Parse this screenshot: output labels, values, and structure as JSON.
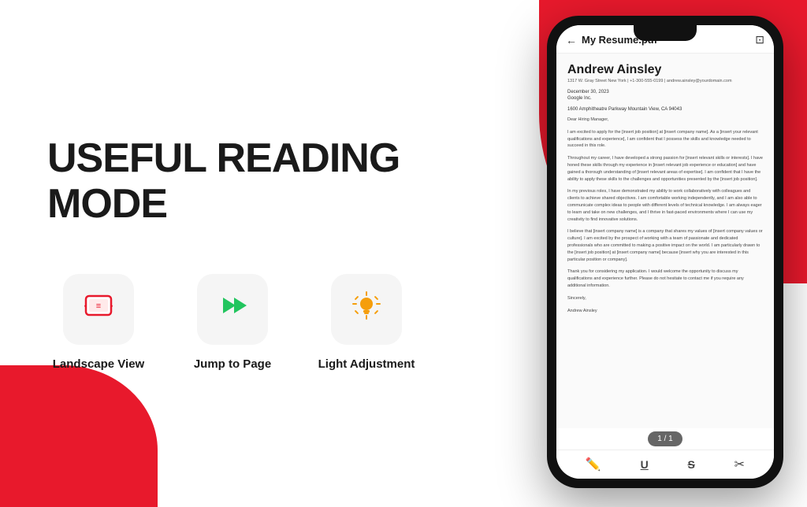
{
  "background": {
    "top_right_color": "#e8192c",
    "bottom_left_color": "#e8192c"
  },
  "left_section": {
    "title": "USEFUL READING MODE",
    "features": [
      {
        "id": "landscape-view",
        "icon": "📄",
        "icon_symbol": "⬛",
        "label": "Landscape View",
        "icon_color": "red"
      },
      {
        "id": "jump-to-page",
        "icon": "⏩",
        "label": "Jump to Page",
        "icon_color": "green"
      },
      {
        "id": "light-adjustment",
        "icon": "💡",
        "label": "Light Adjustment",
        "icon_color": "yellow"
      }
    ]
  },
  "phone": {
    "header": {
      "back_label": "←",
      "title": "My Resume.pdf",
      "menu_icon": "⊡"
    },
    "resume": {
      "name": "Andrew Ainsley",
      "contact": "1317 W. Gray Street  New York | +1-300-555-0199 | andrew.ainsley@yourdomain.com",
      "date": "December 30, 2023",
      "company_name": "Google Inc.",
      "company_address": "1600 Amphitheatre Parkway Mountain View, CA 94043",
      "salutation": "Dear Hiring Manager,",
      "paragraphs": [
        "I am excited to apply for the [insert job position] at [insert company name]. As a [insert your relevant qualifications and experience], I am confident that I possess the skills and knowledge needed to succeed in this role.",
        "Throughout my career, I have developed a strong passion for [insert relevant skills or interests]. I have honed these skills through my experience in [insert relevant job experience or education] and have gained a thorough understanding of [insert relevant areas of expertise]. I am confident that I have the ability to apply these skills to the challenges and opportunities presented by the [insert job position].",
        "In my previous roles, I have demonstrated my ability to work collaboratively with colleagues and clients to achieve shared objectives. I am comfortable working independently, and I am also able to communicate complex ideas to people with different levels of technical knowledge. I am always eager to learn and take on new challenges, and I thrive in fast-paced environments where I can use my creativity to find innovative solutions.",
        "I believe that [insert company name] is a company that shares my values of [insert company values or culture]. I am excited by the prospect of working with a team of passionate and dedicated professionals who are committed to making a positive impact on the world. I am particularly drawn to the [insert job position] at [insert company name] because [insert why you are interested in this particular position or company].",
        "Thank you for considering my application. I would welcome the opportunity to discuss my qualifications and experience further. Please do not hesitate to contact me if you require any additional information.",
        "Sincerely,"
      ],
      "signature": "Andrew Ainsley"
    },
    "page_indicator": "1 / 1",
    "toolbar_icons": [
      "✏️",
      "U̲",
      "S̶",
      "✂️"
    ]
  }
}
